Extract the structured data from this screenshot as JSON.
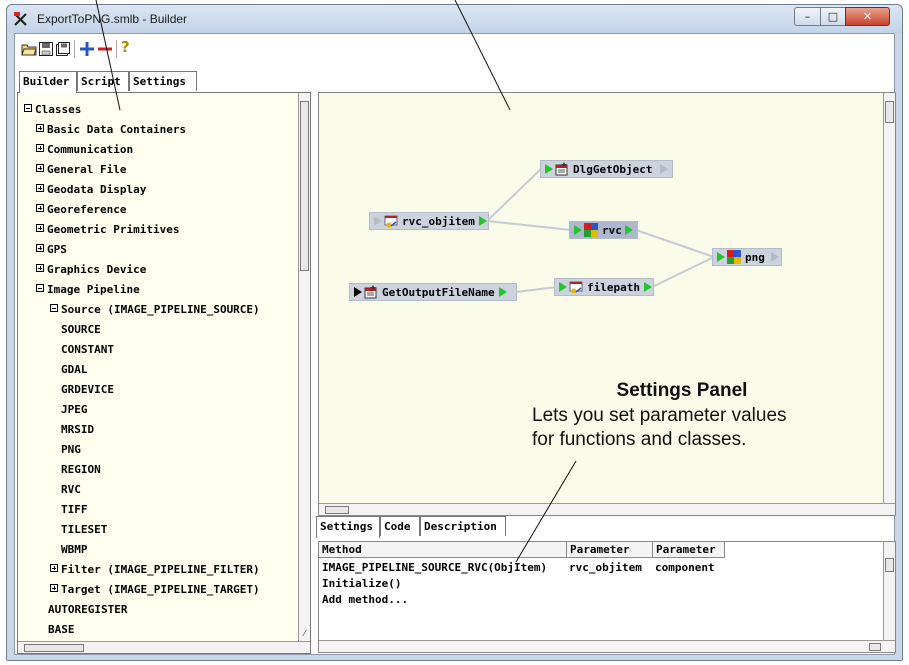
{
  "window": {
    "title": "ExportToPNG.smlb - Builder",
    "controls": {
      "minimize": "–",
      "maximize": "□",
      "close": "✕"
    }
  },
  "toolbar": {
    "icons": [
      "open-folder-icon",
      "save-icon",
      "save-as-icon",
      "add-icon",
      "remove-icon",
      "help-icon"
    ],
    "help_glyph": "?"
  },
  "main_tabs": [
    {
      "label": "Builder",
      "active": true
    },
    {
      "label": "Script",
      "active": false
    },
    {
      "label": "Settings",
      "active": false
    }
  ],
  "tree": {
    "root": "Classes",
    "categories": [
      "Basic Data Containers",
      "Communication",
      "General File",
      "Geodata Display",
      "Georeference",
      "Geometric Primitives",
      "GPS",
      "Graphics Device",
      "Image Pipeline"
    ],
    "source_group": "Source (IMAGE_PIPELINE_SOURCE)",
    "source_items": [
      "SOURCE",
      "CONSTANT",
      "GDAL",
      "GRDEVICE",
      "JPEG",
      "MRSID",
      "PNG",
      "REGION",
      "RVC",
      "TIFF",
      "TILESET",
      "WBMP"
    ],
    "filter_group": "Filter (IMAGE_PIPELINE_FILTER)",
    "target_group": "Target (IMAGE_PIPELINE_TARGET)",
    "trailing_items": [
      "AUTOREGISTER",
      "BASE"
    ]
  },
  "graph": {
    "nodes": {
      "dlg": "DlgGetObject",
      "rvc_objitem": "rvc_objitem",
      "rvc": "rvc",
      "png": "png",
      "getoutput": "GetOutputFileName",
      "filepath": "filepath"
    }
  },
  "settings_tabs": [
    {
      "label": "Settings",
      "active": true
    },
    {
      "label": "Code",
      "active": false
    },
    {
      "label": "Description",
      "active": false
    }
  ],
  "settings_table": {
    "headers": [
      "Method",
      "Parameter",
      "Parameter"
    ],
    "rows": [
      [
        "IMAGE_PIPELINE_SOURCE_RVC(ObjItem)",
        "rvc_objitem",
        "component"
      ],
      [
        "Initialize()",
        "",
        ""
      ],
      [
        "Add method...",
        "",
        ""
      ]
    ]
  },
  "callout": {
    "title": "Settings Panel",
    "line1": "Lets you set parameter values",
    "line2": "for functions and classes."
  },
  "colors": {
    "canvas_bg": "#fbfbe9",
    "tree_bg": "#fffff0",
    "port_green": "#23c42d",
    "node_bg": "#ccd3de",
    "close_red": "#c7432c"
  }
}
